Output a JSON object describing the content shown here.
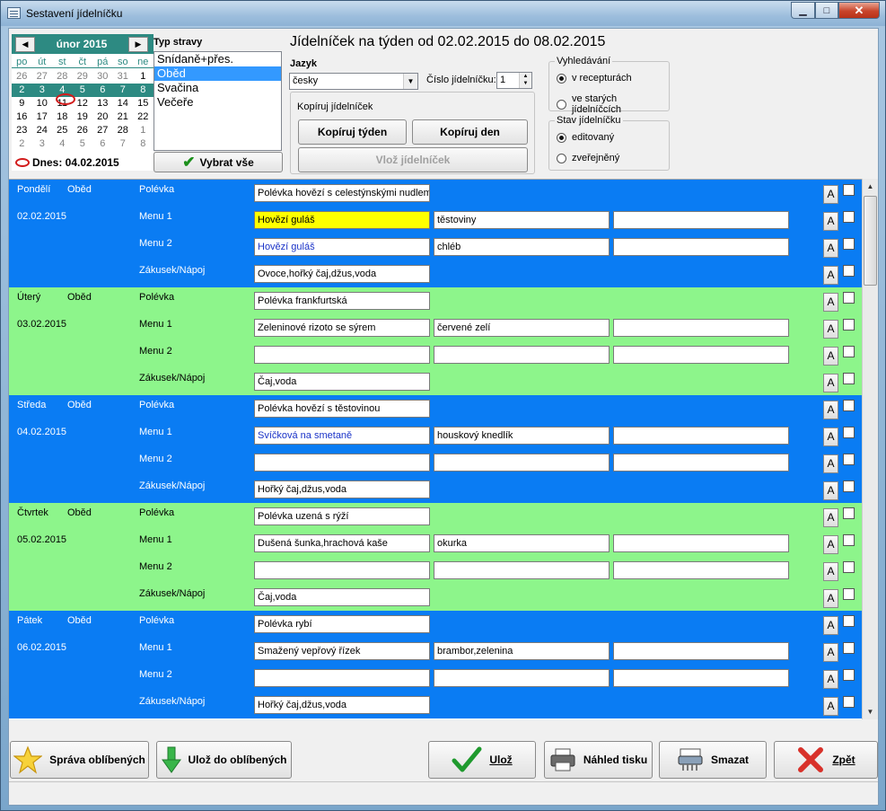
{
  "window": {
    "title": "Sestavení jídelníčku"
  },
  "calendar": {
    "month": "únor 2015",
    "prev": "◀",
    "next": "▶",
    "dow": [
      "po",
      "út",
      "st",
      "čt",
      "pá",
      "so",
      "ne"
    ],
    "weeks": [
      [
        "26",
        "27",
        "28",
        "29",
        "30",
        "31",
        "1"
      ],
      [
        "2",
        "3",
        "4",
        "5",
        "6",
        "7",
        "8"
      ],
      [
        "9",
        "10",
        "11",
        "12",
        "13",
        "14",
        "15"
      ],
      [
        "16",
        "17",
        "18",
        "19",
        "20",
        "21",
        "22"
      ],
      [
        "23",
        "24",
        "25",
        "26",
        "27",
        "28",
        "1"
      ],
      [
        "2",
        "3",
        "4",
        "5",
        "6",
        "7",
        "8"
      ]
    ],
    "today_label": "Dnes: 04.02.2015"
  },
  "meal_type": {
    "label": "Typ stravy",
    "items": [
      "Snídaně+přes.",
      "Oběd",
      "Svačina",
      "Večeře"
    ],
    "selected": "Oběd",
    "select_all": "Vybrat vše"
  },
  "header": {
    "title": "Jídelníček na týden od 02.02.2015 do 08.02.2015",
    "language_label": "Jazyk",
    "language_value": "česky",
    "number_label": "Číslo jídelníčku:",
    "number_value": "1",
    "copy_group": "Kopíruj jídelníček",
    "copy_week": "Kopíruj týden",
    "copy_day": "Kopíruj den",
    "paste": "Vlož jídelníček"
  },
  "search": {
    "title": "Vyhledávání",
    "opt1": "v recepturách",
    "opt2": "ve starých jídelníčcích"
  },
  "state": {
    "title": "Stav jídelníčku",
    "opt1": "editovaný",
    "opt2": "zveřejněný"
  },
  "rows": {
    "soup": "Polévka",
    "menu1": "Menu 1",
    "menu2": "Menu 2",
    "dessert": "Zákusek/Nápoj",
    "meal": "Oběd",
    "a": "A"
  },
  "days": [
    {
      "name": "Pondělí",
      "date": "02.02.2015",
      "soup": "Polévka hovězí s celestýnskými nudlemi",
      "m1": [
        "Hovězí guláš",
        "těstoviny",
        ""
      ],
      "m2": [
        "Hovězí guláš",
        "chléb",
        ""
      ],
      "dessert": "Ovoce,hořký čaj,džus,voda"
    },
    {
      "name": "Úterý",
      "date": "03.02.2015",
      "soup": "Polévka frankfurtská",
      "m1": [
        "Zeleninové rizoto se sýrem",
        "červené zelí",
        ""
      ],
      "m2": [
        "",
        "",
        ""
      ],
      "dessert": "Čaj,voda"
    },
    {
      "name": "Středa",
      "date": "04.02.2015",
      "soup": "Polévka hovězí s těstovinou",
      "m1": [
        "Svíčková na smetaně",
        "houskový knedlík",
        ""
      ],
      "m2": [
        "",
        "",
        ""
      ],
      "dessert": "Hořký čaj,džus,voda"
    },
    {
      "name": "Čtvrtek",
      "date": "05.02.2015",
      "soup": "Polévka uzená s rýží",
      "m1": [
        "Dušená šunka,hrachová kaše",
        "okurka",
        ""
      ],
      "m2": [
        "",
        "",
        ""
      ],
      "dessert": "Čaj,voda"
    },
    {
      "name": "Pátek",
      "date": "06.02.2015",
      "soup": "Polévka rybí",
      "m1": [
        "Smažený vepřový řízek",
        "brambor,zelenina",
        ""
      ],
      "m2": [
        "",
        "",
        ""
      ],
      "dessert": "Hořký čaj,džus,voda"
    }
  ],
  "footer": {
    "favorites_manage": "Správa oblíbených",
    "favorites_save": "Ulož do oblíbených",
    "save": "Ulož",
    "print_preview": "Náhled tisku",
    "delete": "Smazat",
    "back": "Zpět"
  }
}
